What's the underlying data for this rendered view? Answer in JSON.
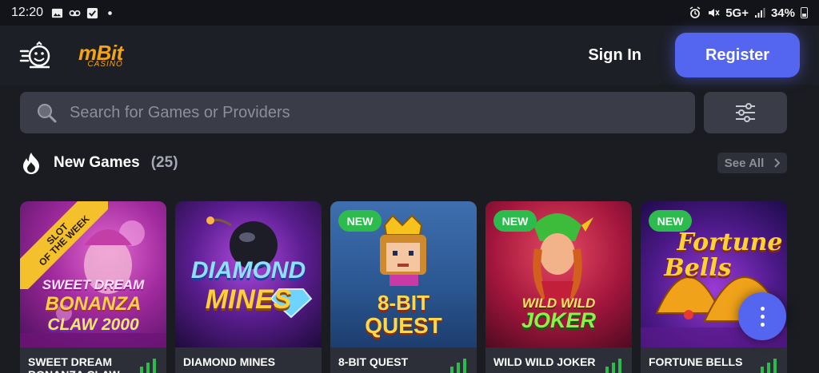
{
  "status_bar": {
    "time": "12:20",
    "network": "5G+",
    "battery": "34%"
  },
  "header": {
    "logo_brand": "mBit",
    "logo_sub": "CASINO",
    "sign_in_label": "Sign In",
    "register_label": "Register"
  },
  "search": {
    "placeholder": "Search for Games or Providers"
  },
  "section": {
    "title": "New Games",
    "count": "(25)",
    "see_all_label": "See All"
  },
  "games": [
    {
      "name": "SWEET DREAM BONANZA CLAW",
      "ribbon_line1": "SLOT",
      "ribbon_line2": "OF THE WEEK",
      "art_line1": "SWEET DREAM",
      "art_line2": "BONANZA",
      "art_line3": "CLAW 2000"
    },
    {
      "name": "DIAMOND MINES",
      "art_line1": "DIAMOND",
      "art_line2": "MINES"
    },
    {
      "name": "8-BIT QUEST",
      "badge": "NEW",
      "art_line1": "8-BIT",
      "art_line2": "QUEST"
    },
    {
      "name": "WILD WILD JOKER",
      "badge": "NEW",
      "art_line1": "WILD WILD",
      "art_line2": "JOKER"
    },
    {
      "name": "FORTUNE BELLS",
      "badge": "NEW",
      "art_line1": "Fortune",
      "art_line2": "Bells"
    }
  ],
  "colors": {
    "accent": "#5465f0",
    "new_badge": "#2dbb4e",
    "logo": "#f2a316",
    "ribbon": "#f4c02c"
  }
}
